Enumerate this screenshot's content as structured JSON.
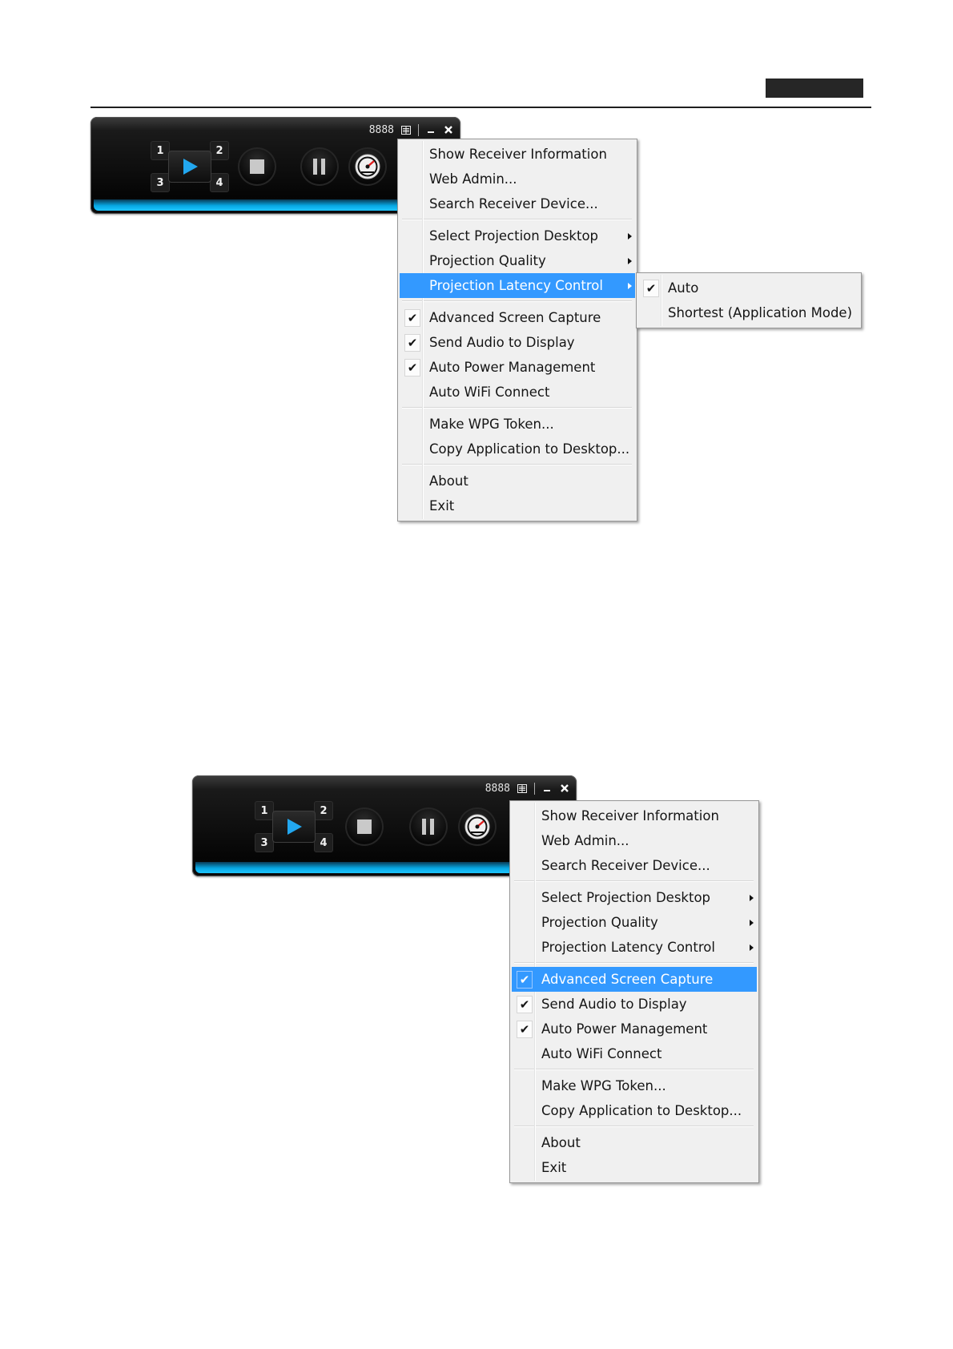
{
  "toolbar": {
    "code": "8888",
    "quadrants": [
      "1",
      "2",
      "3",
      "4"
    ]
  },
  "menu1": {
    "groups": [
      [
        {
          "label": "Show Receiver Information"
        },
        {
          "label": "Web Admin..."
        },
        {
          "label": "Search Receiver Device..."
        }
      ],
      [
        {
          "label": "Select Projection Desktop",
          "submenu": true
        },
        {
          "label": "Projection Quality",
          "submenu": true
        },
        {
          "label": "Projection Latency Control",
          "submenu": true,
          "highlighted": true
        }
      ],
      [
        {
          "label": "Advanced Screen Capture",
          "checked": true
        },
        {
          "label": "Send Audio to Display",
          "checked": true
        },
        {
          "label": "Auto Power Management",
          "checked": true
        },
        {
          "label": "Auto WiFi Connect"
        }
      ],
      [
        {
          "label": "Make WPG Token..."
        },
        {
          "label": "Copy Application to Desktop..."
        }
      ],
      [
        {
          "label": "About"
        },
        {
          "label": "Exit"
        }
      ]
    ],
    "submenu": [
      {
        "label": "Auto",
        "checked": true
      },
      {
        "label": "Shortest (Application Mode)"
      }
    ]
  },
  "menu2": {
    "groups": [
      [
        {
          "label": "Show Receiver Information"
        },
        {
          "label": "Web Admin..."
        },
        {
          "label": "Search Receiver Device..."
        }
      ],
      [
        {
          "label": "Select Projection Desktop",
          "submenu": true
        },
        {
          "label": "Projection Quality",
          "submenu": true
        },
        {
          "label": "Projection Latency Control",
          "submenu": true
        }
      ],
      [
        {
          "label": "Advanced Screen Capture",
          "checked": true,
          "highlighted": true
        },
        {
          "label": "Send Audio to Display",
          "checked": true
        },
        {
          "label": "Auto Power Management",
          "checked": true
        },
        {
          "label": "Auto WiFi Connect"
        }
      ],
      [
        {
          "label": "Make WPG Token..."
        },
        {
          "label": "Copy Application to Desktop..."
        }
      ],
      [
        {
          "label": "About"
        },
        {
          "label": "Exit"
        }
      ]
    ]
  },
  "colors": {
    "highlight": "#3399ff",
    "menu_bg": "#f0f0f0",
    "toolbar_accent": "#07a7e3"
  },
  "icons": [
    "play-icon",
    "stop-icon",
    "pause-icon",
    "speedometer-icon",
    "display-icon",
    "minimize-icon",
    "close-icon",
    "checkmark-icon",
    "submenu-arrow-icon"
  ]
}
